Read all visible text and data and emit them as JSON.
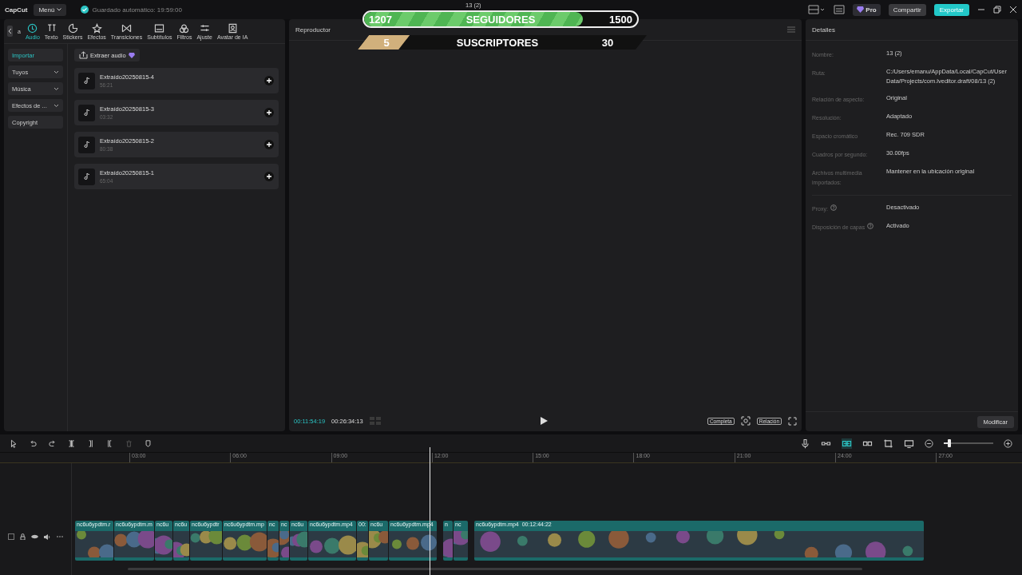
{
  "topbar": {
    "logo": "CapCut",
    "menu": "Menú",
    "autosave": "Guardado automático: 19:59:00",
    "title": "13 (2)",
    "pro": "Pro",
    "share": "Compartir",
    "export": "Exportar"
  },
  "overlay": {
    "followers": {
      "current": "1207",
      "label": "SEGUIDORES",
      "goal": "1500",
      "level": 0.8
    },
    "subscribers": {
      "current": "5",
      "label": "SUSCRIPTORES",
      "goal": "30",
      "level": 0.18
    }
  },
  "tabs": [
    {
      "label": "a",
      "selected": false
    },
    {
      "label": "Audio",
      "selected": true
    },
    {
      "label": "Texto",
      "selected": false
    },
    {
      "label": "Stickers",
      "selected": false
    },
    {
      "label": "Efectos",
      "selected": false
    },
    {
      "label": "Transiciones",
      "selected": false
    },
    {
      "label": "Subtítulos",
      "selected": false
    },
    {
      "label": "Filtros",
      "selected": false
    },
    {
      "label": "Ajuste",
      "selected": false
    },
    {
      "label": "Avatar de IA",
      "selected": false
    }
  ],
  "sidebar": {
    "items": [
      {
        "label": "Importar",
        "selected": true,
        "dropdown": false
      },
      {
        "label": "Tuyos",
        "selected": false,
        "dropdown": true
      },
      {
        "label": "Música",
        "selected": false,
        "dropdown": true
      },
      {
        "label": "Efectos de ...",
        "selected": false,
        "dropdown": true
      },
      {
        "label": "Copyright",
        "selected": false,
        "dropdown": false
      }
    ]
  },
  "extract_button": "Extraer audio",
  "audio_items": [
    {
      "name": "Extraído20250815-4",
      "duration": "56:21"
    },
    {
      "name": "Extraído20250815-3",
      "duration": "03:32"
    },
    {
      "name": "Extraído20250815-2",
      "duration": "80:38"
    },
    {
      "name": "Extraído20250815-1",
      "duration": "65:04"
    }
  ],
  "player": {
    "title": "Reproductor",
    "current_time": "00:11:54:19",
    "total_time": "00:26:34:13",
    "full_button": "Completa",
    "ratio_button": "Relación"
  },
  "details": {
    "title": "Detalles",
    "rows": [
      {
        "label": "Nombre:",
        "value": "13 (2)",
        "help": false
      },
      {
        "label": "Ruta:",
        "value": "C:/Users/emanu/AppData/Local/CapCut/User Data/Projects/com.lveditor.draft/08/13 (2)",
        "help": false
      },
      {
        "label": "Relación de aspecto:",
        "value": "Original",
        "help": false
      },
      {
        "label": "Resolución:",
        "value": "Adaptado",
        "help": false
      },
      {
        "label": "Espacio cromático",
        "value": "Rec. 709 SDR",
        "help": false
      },
      {
        "label": "Cuadros por segundo:",
        "value": "30.00fps",
        "help": false
      },
      {
        "label": "Archivos multimedia importados:",
        "value": "Mantener en la ubicación original",
        "help": false
      },
      {
        "label": "Proxy:",
        "value": "Desactivado",
        "help": true
      },
      {
        "label": "Disposición de capas",
        "value": "Activado",
        "help": true
      }
    ],
    "modify_button": "Modificar"
  },
  "timeline": {
    "ruler": [
      "03:00",
      "06:00",
      "09:00",
      "12:00",
      "15:00",
      "18:00",
      "21:00",
      "24:00",
      "27:00"
    ],
    "zoom": {
      "level": 0.12
    },
    "clips": [
      {
        "label": "nc6u6ypdtm.r"
      },
      {
        "label": "nc6u6ypdtm.m"
      },
      {
        "label": "nc6u"
      },
      {
        "label": "nc6u"
      },
      {
        "label": "nc6u6ypdtr"
      },
      {
        "label": "nc6u6ypdtm.mp"
      },
      {
        "label": "nc"
      },
      {
        "label": "nc"
      },
      {
        "label": "nc6u"
      },
      {
        "label": "nc6u6ypdtm.mp4"
      },
      {
        "label": "00:"
      },
      {
        "label": "nc6u"
      },
      {
        "label": "nc6u6ypdtm.mp4"
      },
      {
        "label": "n"
      },
      {
        "label": "nc"
      },
      {
        "label": "nc6u6ypdtm.mp4",
        "duration": "00:12:44:22"
      }
    ]
  }
}
